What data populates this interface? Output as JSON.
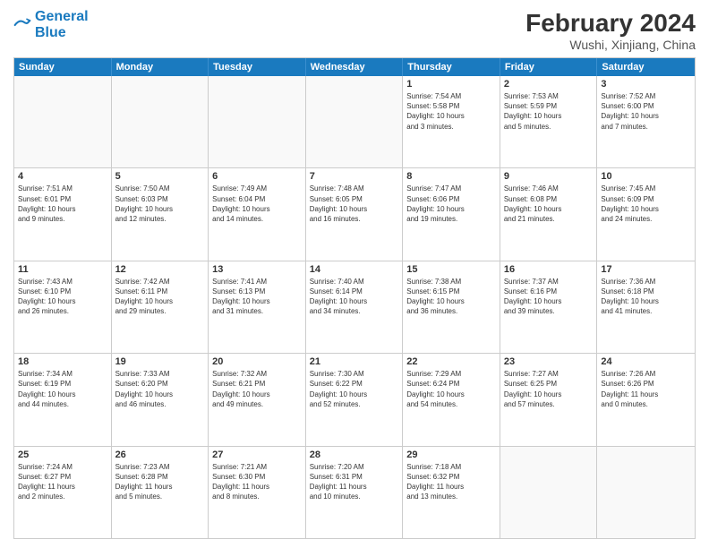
{
  "header": {
    "logo_line1": "General",
    "logo_line2": "Blue",
    "month_year": "February 2024",
    "location": "Wushi, Xinjiang, China"
  },
  "days_of_week": [
    "Sunday",
    "Monday",
    "Tuesday",
    "Wednesday",
    "Thursday",
    "Friday",
    "Saturday"
  ],
  "rows": [
    [
      {
        "day": "",
        "info": ""
      },
      {
        "day": "",
        "info": ""
      },
      {
        "day": "",
        "info": ""
      },
      {
        "day": "",
        "info": ""
      },
      {
        "day": "1",
        "info": "Sunrise: 7:54 AM\nSunset: 5:58 PM\nDaylight: 10 hours\nand 3 minutes."
      },
      {
        "day": "2",
        "info": "Sunrise: 7:53 AM\nSunset: 5:59 PM\nDaylight: 10 hours\nand 5 minutes."
      },
      {
        "day": "3",
        "info": "Sunrise: 7:52 AM\nSunset: 6:00 PM\nDaylight: 10 hours\nand 7 minutes."
      }
    ],
    [
      {
        "day": "4",
        "info": "Sunrise: 7:51 AM\nSunset: 6:01 PM\nDaylight: 10 hours\nand 9 minutes."
      },
      {
        "day": "5",
        "info": "Sunrise: 7:50 AM\nSunset: 6:03 PM\nDaylight: 10 hours\nand 12 minutes."
      },
      {
        "day": "6",
        "info": "Sunrise: 7:49 AM\nSunset: 6:04 PM\nDaylight: 10 hours\nand 14 minutes."
      },
      {
        "day": "7",
        "info": "Sunrise: 7:48 AM\nSunset: 6:05 PM\nDaylight: 10 hours\nand 16 minutes."
      },
      {
        "day": "8",
        "info": "Sunrise: 7:47 AM\nSunset: 6:06 PM\nDaylight: 10 hours\nand 19 minutes."
      },
      {
        "day": "9",
        "info": "Sunrise: 7:46 AM\nSunset: 6:08 PM\nDaylight: 10 hours\nand 21 minutes."
      },
      {
        "day": "10",
        "info": "Sunrise: 7:45 AM\nSunset: 6:09 PM\nDaylight: 10 hours\nand 24 minutes."
      }
    ],
    [
      {
        "day": "11",
        "info": "Sunrise: 7:43 AM\nSunset: 6:10 PM\nDaylight: 10 hours\nand 26 minutes."
      },
      {
        "day": "12",
        "info": "Sunrise: 7:42 AM\nSunset: 6:11 PM\nDaylight: 10 hours\nand 29 minutes."
      },
      {
        "day": "13",
        "info": "Sunrise: 7:41 AM\nSunset: 6:13 PM\nDaylight: 10 hours\nand 31 minutes."
      },
      {
        "day": "14",
        "info": "Sunrise: 7:40 AM\nSunset: 6:14 PM\nDaylight: 10 hours\nand 34 minutes."
      },
      {
        "day": "15",
        "info": "Sunrise: 7:38 AM\nSunset: 6:15 PM\nDaylight: 10 hours\nand 36 minutes."
      },
      {
        "day": "16",
        "info": "Sunrise: 7:37 AM\nSunset: 6:16 PM\nDaylight: 10 hours\nand 39 minutes."
      },
      {
        "day": "17",
        "info": "Sunrise: 7:36 AM\nSunset: 6:18 PM\nDaylight: 10 hours\nand 41 minutes."
      }
    ],
    [
      {
        "day": "18",
        "info": "Sunrise: 7:34 AM\nSunset: 6:19 PM\nDaylight: 10 hours\nand 44 minutes."
      },
      {
        "day": "19",
        "info": "Sunrise: 7:33 AM\nSunset: 6:20 PM\nDaylight: 10 hours\nand 46 minutes."
      },
      {
        "day": "20",
        "info": "Sunrise: 7:32 AM\nSunset: 6:21 PM\nDaylight: 10 hours\nand 49 minutes."
      },
      {
        "day": "21",
        "info": "Sunrise: 7:30 AM\nSunset: 6:22 PM\nDaylight: 10 hours\nand 52 minutes."
      },
      {
        "day": "22",
        "info": "Sunrise: 7:29 AM\nSunset: 6:24 PM\nDaylight: 10 hours\nand 54 minutes."
      },
      {
        "day": "23",
        "info": "Sunrise: 7:27 AM\nSunset: 6:25 PM\nDaylight: 10 hours\nand 57 minutes."
      },
      {
        "day": "24",
        "info": "Sunrise: 7:26 AM\nSunset: 6:26 PM\nDaylight: 11 hours\nand 0 minutes."
      }
    ],
    [
      {
        "day": "25",
        "info": "Sunrise: 7:24 AM\nSunset: 6:27 PM\nDaylight: 11 hours\nand 2 minutes."
      },
      {
        "day": "26",
        "info": "Sunrise: 7:23 AM\nSunset: 6:28 PM\nDaylight: 11 hours\nand 5 minutes."
      },
      {
        "day": "27",
        "info": "Sunrise: 7:21 AM\nSunset: 6:30 PM\nDaylight: 11 hours\nand 8 minutes."
      },
      {
        "day": "28",
        "info": "Sunrise: 7:20 AM\nSunset: 6:31 PM\nDaylight: 11 hours\nand 10 minutes."
      },
      {
        "day": "29",
        "info": "Sunrise: 7:18 AM\nSunset: 6:32 PM\nDaylight: 11 hours\nand 13 minutes."
      },
      {
        "day": "",
        "info": ""
      },
      {
        "day": "",
        "info": ""
      }
    ]
  ]
}
